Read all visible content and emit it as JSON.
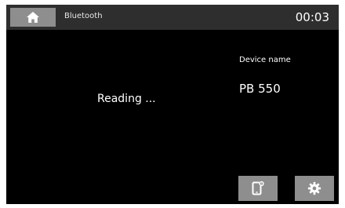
{
  "header": {
    "home_icon": "home-icon",
    "title": "Bluetooth",
    "clock": "00:03"
  },
  "main": {
    "status": "Reading ...",
    "device_name_label": "Device name",
    "device_name_value": "PB 550"
  },
  "actions": {
    "device_icon": "device-settings-icon",
    "settings_icon": "gear-icon"
  },
  "colors": {
    "background": "#000000",
    "titlebar": "#2e2e2e",
    "button": "#8e8e8e",
    "text": "#ffffff"
  }
}
